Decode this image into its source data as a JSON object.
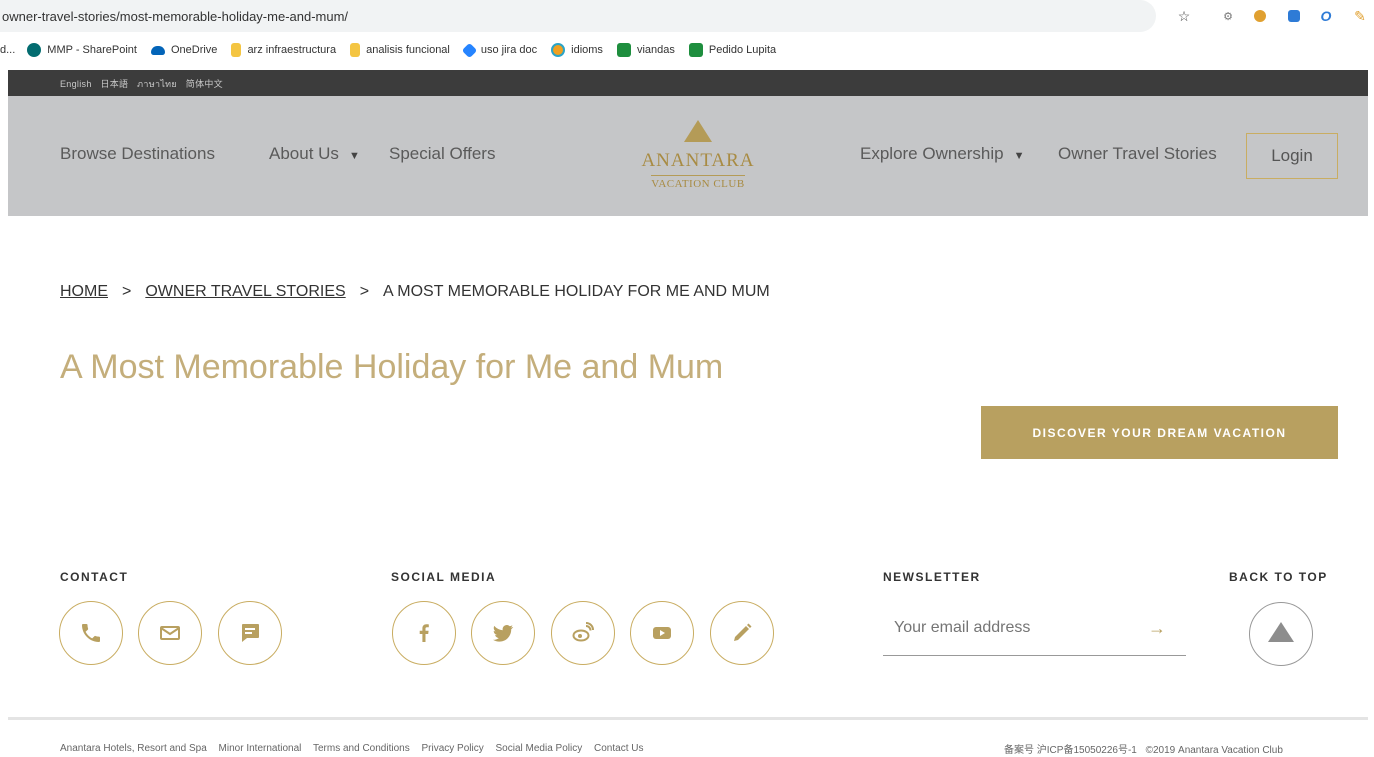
{
  "browser": {
    "url": "owner-travel-stories/most-memorable-holiday-me-and-mum/",
    "bookmarks": [
      {
        "label": "d...",
        "color": "#888888"
      },
      {
        "label": "MMP - SharePoint",
        "color": "#036c70"
      },
      {
        "label": "OneDrive",
        "color": "#0364b8"
      },
      {
        "label": "arz infraestructura",
        "color": "#f4c542"
      },
      {
        "label": "analisis funcional",
        "color": "#f4c542"
      },
      {
        "label": "uso jira doc",
        "color": "#2684ff"
      },
      {
        "label": "idioms",
        "color": "#f0a020"
      },
      {
        "label": "viandas",
        "color": "#1e8e3e"
      },
      {
        "label": "Pedido Lupita",
        "color": "#1e8e3e"
      }
    ]
  },
  "langbar": {
    "languages": [
      "English",
      "日本語",
      "ภาษาไทย",
      "简体中文"
    ]
  },
  "header": {
    "nav_left": [
      "Browse Destinations",
      "About Us",
      "Special Offers"
    ],
    "logo_name": "ANANTARA",
    "logo_sub": "VACATION CLUB",
    "nav_right": [
      "Explore Ownership",
      "Owner Travel Stories"
    ],
    "login": "Login",
    "caret": "▼"
  },
  "breadcrumb": {
    "home": "HOME",
    "stories": "OWNER TRAVEL STORIES",
    "current": "A MOST MEMORABLE HOLIDAY FOR ME AND MUM",
    "separator": ">"
  },
  "page": {
    "title": "A Most Memorable Holiday for Me and Mum",
    "cta": "DISCOVER YOUR DREAM VACATION"
  },
  "footer": {
    "contact_heading": "CONTACT",
    "social_heading": "SOCIAL MEDIA",
    "newsletter_heading": "NEWSLETTER",
    "backtop_heading": "BACK TO TOP",
    "email_placeholder": "Your email address",
    "submit_arrow": "→",
    "links": [
      "Anantara Hotels, Resort and Spa",
      "Minor International",
      "Terms and Conditions",
      "Privacy Policy",
      "Social Media Policy",
      "Contact Us"
    ],
    "registration": "备案号 沪ICP备15050226号-1",
    "copyright": "©2019 Anantara Vacation Club"
  },
  "colors": {
    "gold": "#b8a060",
    "header_bg": "#c5c6c8",
    "langbar_bg": "#3c3c3c"
  }
}
